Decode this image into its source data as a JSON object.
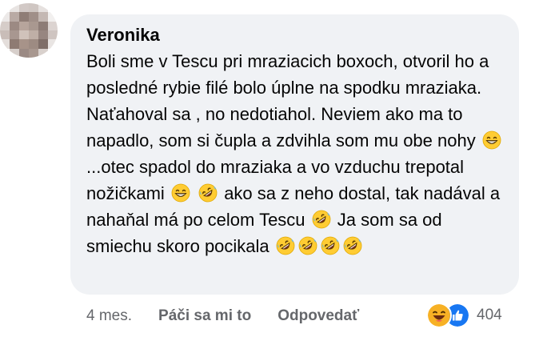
{
  "comment": {
    "author": "Veronika",
    "text_parts": [
      "Boli sme v Tescu pri mraziacich boxoch, otvoril ho a posledné rybie filé bolo úplne na spodku mraziaka. Naťahoval sa , no nedotiahol. Neviem ako ma to napadlo, som si čupla a zdvihla som mu obe nohy",
      "...otec spadol do mraziaka a vo vzduchu trepotal nožičkami",
      "ako sa z neho dostal, tak nadával a nahaňal má po celom Tescu",
      "Ja som sa od smiechu skoro pocikala"
    ],
    "emoji_names": [
      "grin-emoji",
      "rofl-emoji"
    ]
  },
  "actions": {
    "time": "4 mes.",
    "like_label": "Páči sa mi to",
    "reply_label": "Odpovedať"
  },
  "reactions": {
    "icons": [
      "haha-reaction-icon",
      "like-reaction-icon"
    ],
    "count": "404",
    "colors": {
      "haha": "#f7b125",
      "like": "#1877f2"
    }
  },
  "colors": {
    "bubble": "#f0f2f5",
    "meta_text": "#65676b",
    "text": "#050505"
  }
}
